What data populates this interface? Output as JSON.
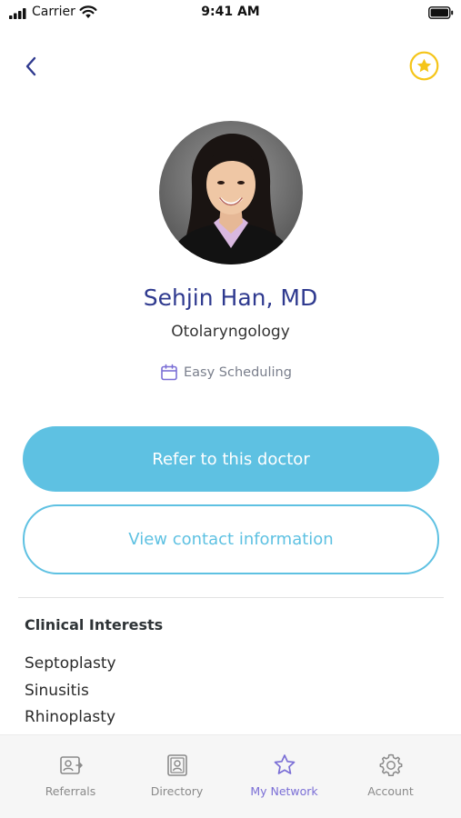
{
  "status_bar": {
    "carrier": "Carrier",
    "time": "9:41 AM"
  },
  "nav": {
    "back_icon": "chevron-left-icon",
    "favorite_icon": "star-icon",
    "favorite_color": "#f5c518"
  },
  "profile": {
    "name": "Sehjin Han, MD",
    "specialty": "Otolaryngology",
    "badge_icon": "calendar-icon",
    "badge_label": "Easy Scheduling"
  },
  "actions": {
    "refer_label": "Refer to this doctor",
    "contact_label": "View contact information"
  },
  "clinical_interests": {
    "title": "Clinical Interests",
    "items": [
      "Septoplasty",
      "Sinusitis",
      "Rhinoplasty"
    ]
  },
  "tab_bar": {
    "tabs": [
      {
        "label": "Referrals",
        "icon": "referral-card-icon",
        "active": false
      },
      {
        "label": "Directory",
        "icon": "directory-icon",
        "active": false
      },
      {
        "label": "My Network",
        "icon": "star-icon",
        "active": true
      },
      {
        "label": "Account",
        "icon": "gear-icon",
        "active": false
      }
    ]
  },
  "colors": {
    "accent": "#5ec1e2",
    "name_text": "#2f3a8f",
    "active_tab": "#7b6fd6"
  }
}
